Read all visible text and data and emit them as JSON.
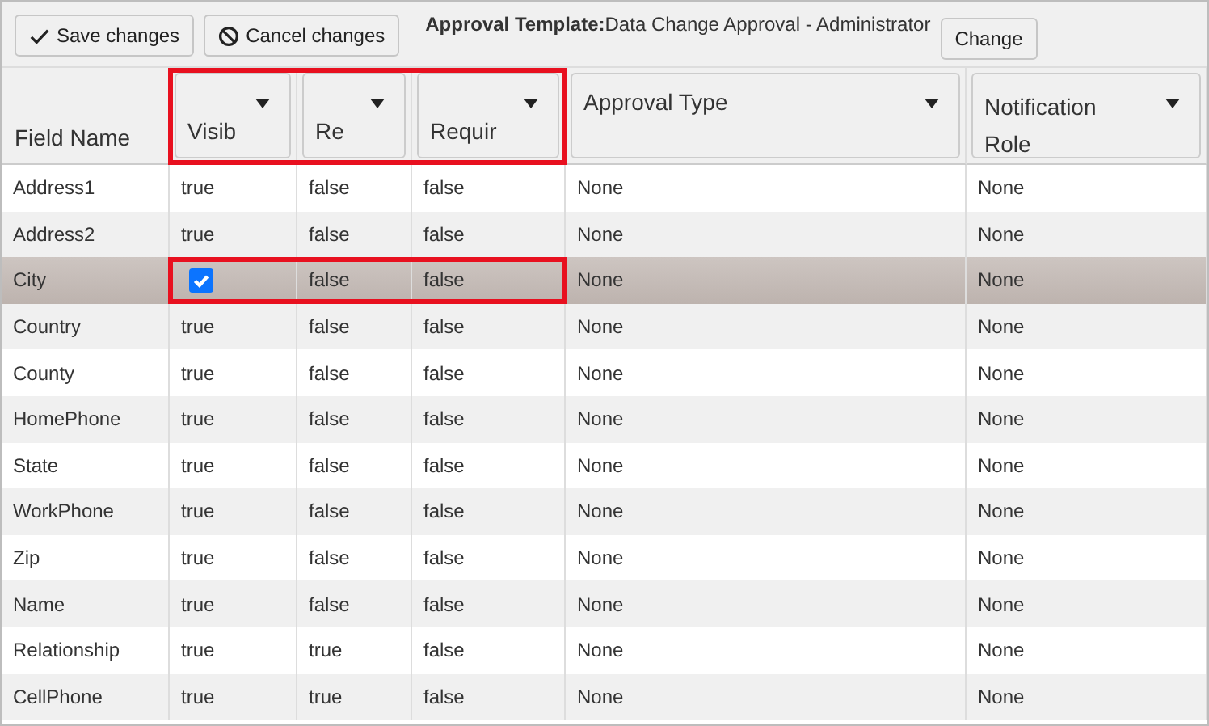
{
  "toolbar": {
    "buttons": [
      {
        "kind": "save",
        "label": "Save changes"
      },
      {
        "kind": "cancel",
        "label": "Cancel changes"
      }
    ],
    "template_label": "Approval Template:",
    "template_name": "Data Change Approval - Administrator",
    "change_button": "Change"
  },
  "table": {
    "columns": [
      {
        "label": "Field Name",
        "kind": "plain",
        "highlighted": false
      },
      {
        "label": "Visib",
        "kind": "filter",
        "highlighted": true
      },
      {
        "label": "Re",
        "kind": "filter",
        "highlighted": true
      },
      {
        "label": "Requir",
        "kind": "filter",
        "highlighted": true
      },
      {
        "label": "Approval Type",
        "kind": "filter",
        "highlighted": false
      },
      {
        "label": "Notification Role",
        "kind": "filter",
        "highlighted": false
      }
    ],
    "rows": [
      {
        "selected": false,
        "highlighted": false,
        "cells": [
          {
            "kind": "text",
            "text": "Address1"
          },
          {
            "kind": "text",
            "text": "true"
          },
          {
            "kind": "text",
            "text": "false"
          },
          {
            "kind": "text",
            "text": "false"
          },
          {
            "kind": "text",
            "text": "None"
          },
          {
            "kind": "text",
            "text": "None"
          }
        ]
      },
      {
        "selected": false,
        "highlighted": false,
        "cells": [
          {
            "kind": "text",
            "text": "Address2"
          },
          {
            "kind": "text",
            "text": "true"
          },
          {
            "kind": "text",
            "text": "false"
          },
          {
            "kind": "text",
            "text": "false"
          },
          {
            "kind": "text",
            "text": "None"
          },
          {
            "kind": "text",
            "text": "None"
          }
        ]
      },
      {
        "selected": true,
        "highlighted": true,
        "cells": [
          {
            "kind": "text",
            "text": "City"
          },
          {
            "kind": "checkbox",
            "checked": true
          },
          {
            "kind": "text",
            "text": "false"
          },
          {
            "kind": "text",
            "text": "false"
          },
          {
            "kind": "text",
            "text": "None"
          },
          {
            "kind": "text",
            "text": "None"
          }
        ]
      },
      {
        "selected": false,
        "highlighted": false,
        "cells": [
          {
            "kind": "text",
            "text": "Country"
          },
          {
            "kind": "text",
            "text": "true"
          },
          {
            "kind": "text",
            "text": "false"
          },
          {
            "kind": "text",
            "text": "false"
          },
          {
            "kind": "text",
            "text": "None"
          },
          {
            "kind": "text",
            "text": "None"
          }
        ]
      },
      {
        "selected": false,
        "highlighted": false,
        "cells": [
          {
            "kind": "text",
            "text": "County"
          },
          {
            "kind": "text",
            "text": "true"
          },
          {
            "kind": "text",
            "text": "false"
          },
          {
            "kind": "text",
            "text": "false"
          },
          {
            "kind": "text",
            "text": "None"
          },
          {
            "kind": "text",
            "text": "None"
          }
        ]
      },
      {
        "selected": false,
        "highlighted": false,
        "cells": [
          {
            "kind": "text",
            "text": "HomePhone"
          },
          {
            "kind": "text",
            "text": "true"
          },
          {
            "kind": "text",
            "text": "false"
          },
          {
            "kind": "text",
            "text": "false"
          },
          {
            "kind": "text",
            "text": "None"
          },
          {
            "kind": "text",
            "text": "None"
          }
        ]
      },
      {
        "selected": false,
        "highlighted": false,
        "cells": [
          {
            "kind": "text",
            "text": "State"
          },
          {
            "kind": "text",
            "text": "true"
          },
          {
            "kind": "text",
            "text": "false"
          },
          {
            "kind": "text",
            "text": "false"
          },
          {
            "kind": "text",
            "text": "None"
          },
          {
            "kind": "text",
            "text": "None"
          }
        ]
      },
      {
        "selected": false,
        "highlighted": false,
        "cells": [
          {
            "kind": "text",
            "text": "WorkPhone"
          },
          {
            "kind": "text",
            "text": "true"
          },
          {
            "kind": "text",
            "text": "false"
          },
          {
            "kind": "text",
            "text": "false"
          },
          {
            "kind": "text",
            "text": "None"
          },
          {
            "kind": "text",
            "text": "None"
          }
        ]
      },
      {
        "selected": false,
        "highlighted": false,
        "cells": [
          {
            "kind": "text",
            "text": "Zip"
          },
          {
            "kind": "text",
            "text": "true"
          },
          {
            "kind": "text",
            "text": "false"
          },
          {
            "kind": "text",
            "text": "false"
          },
          {
            "kind": "text",
            "text": "None"
          },
          {
            "kind": "text",
            "text": "None"
          }
        ]
      },
      {
        "selected": false,
        "highlighted": false,
        "cells": [
          {
            "kind": "text",
            "text": "Name"
          },
          {
            "kind": "text",
            "text": "true"
          },
          {
            "kind": "text",
            "text": "false"
          },
          {
            "kind": "text",
            "text": "false"
          },
          {
            "kind": "text",
            "text": "None"
          },
          {
            "kind": "text",
            "text": "None"
          }
        ]
      },
      {
        "selected": false,
        "highlighted": false,
        "cells": [
          {
            "kind": "text",
            "text": "Relationship"
          },
          {
            "kind": "text",
            "text": "true"
          },
          {
            "kind": "text",
            "text": "true"
          },
          {
            "kind": "text",
            "text": "false"
          },
          {
            "kind": "text",
            "text": "None"
          },
          {
            "kind": "text",
            "text": "None"
          }
        ]
      },
      {
        "selected": false,
        "highlighted": false,
        "cells": [
          {
            "kind": "text",
            "text": "CellPhone"
          },
          {
            "kind": "text",
            "text": "true"
          },
          {
            "kind": "text",
            "text": "true"
          },
          {
            "kind": "text",
            "text": "false"
          },
          {
            "kind": "text",
            "text": "None"
          },
          {
            "kind": "text",
            "text": "None"
          }
        ]
      }
    ]
  }
}
